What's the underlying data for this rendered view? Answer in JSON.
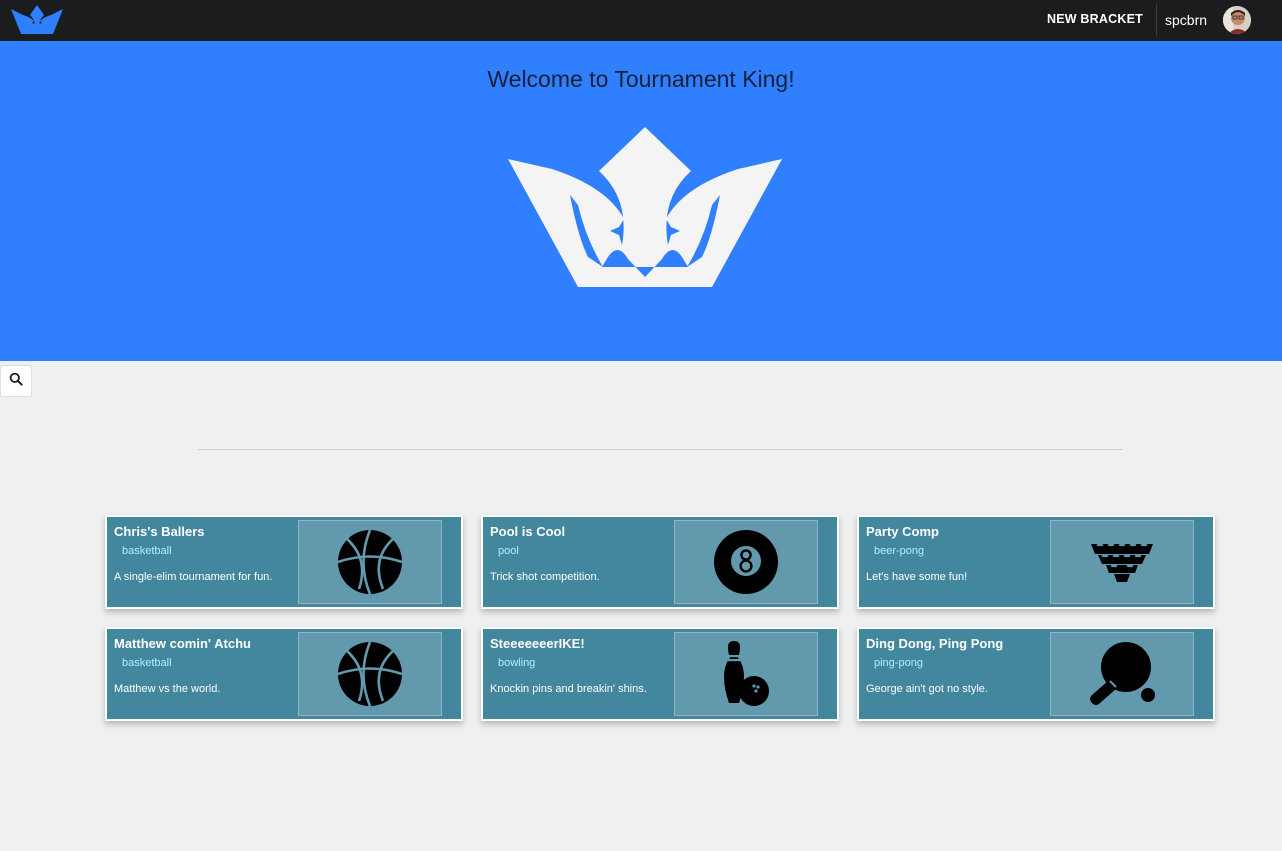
{
  "nav": {
    "new_bracket_label": "NEW BRACKET",
    "username": "spcbrn",
    "logo_icon": "crown-logo-icon",
    "accent_color": "#2f7fff"
  },
  "hero": {
    "title": "Welcome to Tournament King!",
    "background_color": "#2f7fff",
    "crown_icon": "crown-icon"
  },
  "search": {
    "icon": "search-icon"
  },
  "tournaments": [
    {
      "title": "Chris's Ballers",
      "tag": "basketball",
      "description": "A single-elim tournament for fun.",
      "icon": "basketball-icon"
    },
    {
      "title": "Pool is Cool",
      "tag": "pool",
      "description": "Trick shot competition.",
      "icon": "eight-ball-icon"
    },
    {
      "title": "Party Comp",
      "tag": "beer-pong",
      "description": "Let's have some fun!",
      "icon": "beer-pong-icon"
    },
    {
      "title": "Matthew comin' Atchu",
      "tag": "basketball",
      "description": "Matthew vs the world.",
      "icon": "basketball-icon"
    },
    {
      "title": "SteeeeeeerIKE!",
      "tag": "bowling",
      "description": "Knockin pins and breakin' shins.",
      "icon": "bowling-icon"
    },
    {
      "title": "Ding Dong, Ping Pong",
      "tag": "ping-pong",
      "description": "George ain't got no style.",
      "icon": "ping-pong-icon"
    }
  ],
  "card_colors": {
    "background": "#43879f",
    "image_panel": "#6399ac",
    "tag": "#b4ecff"
  }
}
